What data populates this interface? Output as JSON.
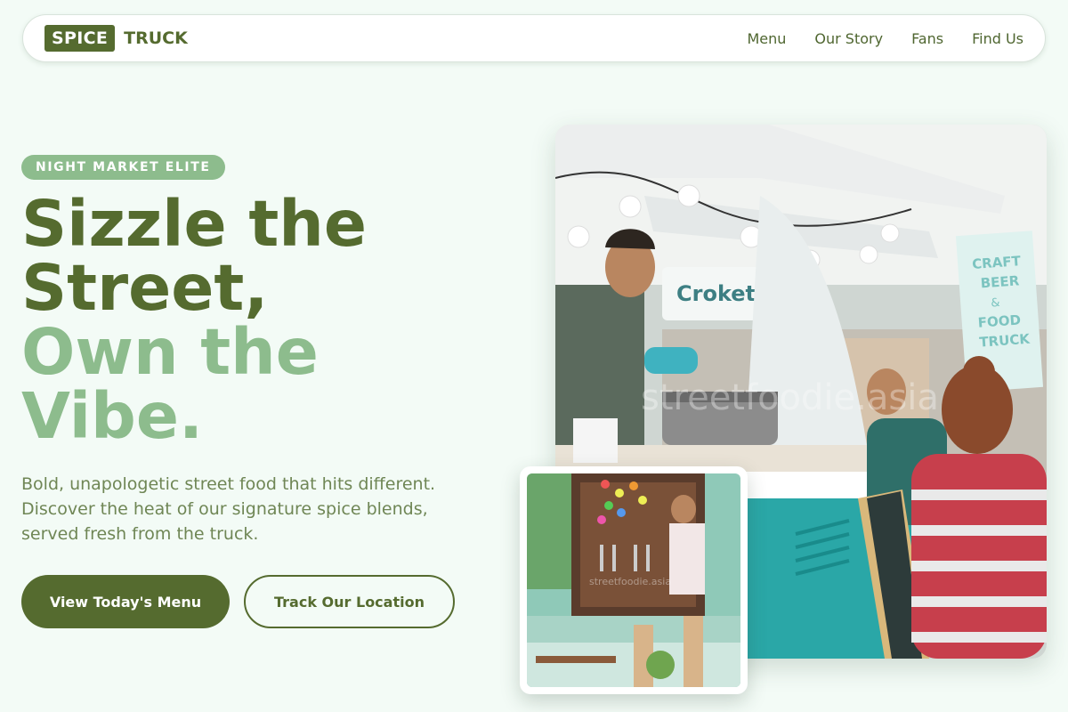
{
  "nav": {
    "logo_box": "SPICE",
    "logo_word": "TRUCK",
    "links": [
      "Menu",
      "Our Story",
      "Fans",
      "Find Us"
    ]
  },
  "hero": {
    "badge": "NIGHT MARKET ELITE",
    "headline_dark_1": "Sizzle the",
    "headline_dark_2": "Street,",
    "headline_light_1": "Own the",
    "headline_light_2": "Vibe.",
    "description": "Bold, unapologetic street food that hits different. Discover the heat of our signature spice blends, served fresh from the truck.",
    "primary_button": "View Today's Menu",
    "secondary_button": "Track Our Location"
  },
  "photo": {
    "sign_croketas": "Croketas",
    "sign_craft": "CRAFT BEER & FOOD TRUCK",
    "watermark": "streetfoodie.asia",
    "inset_watermark": "streetfoodie.asia"
  },
  "colors": {
    "brand_dark": "#556b2f",
    "brand_light": "#8dbc8d",
    "background": "#f3fbf6"
  }
}
